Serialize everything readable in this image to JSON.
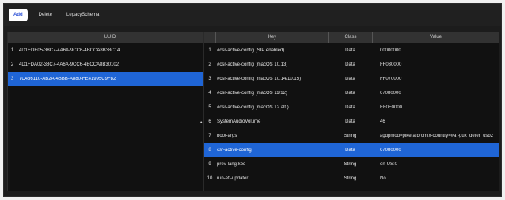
{
  "toolbar": {
    "add_label": "Add",
    "delete_label": "Delete",
    "legacy_label": "LegacySchema"
  },
  "uuid_table": {
    "header": "UUID",
    "rows": [
      {
        "index": "1",
        "uuid": "4D1EDE05-38C7-4A6A-9CC6-4BCCA8B38C14"
      },
      {
        "index": "2",
        "uuid": "4D1FDA02-38C7-4A6A-9CC6-4BCCA8B30102"
      },
      {
        "index": "3",
        "uuid": "7C436110-AB2A-4BBB-A880-FE41995C9F82"
      }
    ],
    "selected_index": 2
  },
  "kv_table": {
    "headers": {
      "key": "Key",
      "class": "Class",
      "value": "Value"
    },
    "rows": [
      {
        "index": "1",
        "key": "#csr-active-config (SIP enabled)",
        "class": "Data",
        "value": "00000000"
      },
      {
        "index": "2",
        "key": "#csr-active-config (macOS 10.13)",
        "class": "Data",
        "value": "FF030000"
      },
      {
        "index": "3",
        "key": "#csr-active-config (macOS 10.14/10.15)",
        "class": "Data",
        "value": "FF070000"
      },
      {
        "index": "4",
        "key": "#csr-active-config (macOS 11/12)",
        "class": "Data",
        "value": "67080000"
      },
      {
        "index": "5",
        "key": "#csr-active-config (macOS 12 alt.)",
        "class": "Data",
        "value": "EF0F0000"
      },
      {
        "index": "6",
        "key": "SystemAudioVolume",
        "class": "Data",
        "value": "46"
      },
      {
        "index": "7",
        "key": "boot-args",
        "class": "String",
        "value": "agdpmod=pikera brcmfx-country=#a -gux_defer_usb2"
      },
      {
        "index": "8",
        "key": "csr-active-config",
        "class": "Data",
        "value": "67080000"
      },
      {
        "index": "9",
        "key": "prev-lang:kbd",
        "class": "String",
        "value": "en-US:0"
      },
      {
        "index": "10",
        "key": "run-efi-updater",
        "class": "String",
        "value": "No"
      }
    ],
    "selected_index": 7
  },
  "row_marker": "•",
  "colors": {
    "selection": "#1f65d6",
    "background": "#111111",
    "header": "#323232"
  }
}
